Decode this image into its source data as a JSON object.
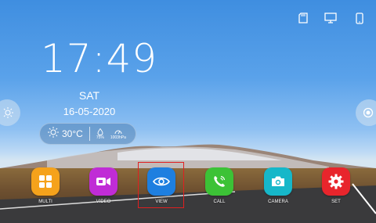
{
  "status_bar": {
    "icons": [
      "sd-card-icon",
      "screen-mirror-icon",
      "phone-icon"
    ]
  },
  "clock": {
    "time": "17:49",
    "day": "SAT",
    "date": "16-05-2020"
  },
  "weather": {
    "temperature": "30°C",
    "humidity": "75%",
    "pressure": "1003hPa"
  },
  "dock": {
    "apps": [
      {
        "label": "MULTI",
        "color": "#f5a21b",
        "icon": "grid-icon"
      },
      {
        "label": "VIDEO",
        "color": "#c02cd6",
        "icon": "video-icon"
      },
      {
        "label": "VIEW",
        "color": "#1e7fe0",
        "icon": "eye-icon"
      },
      {
        "label": "CALL",
        "color": "#3cc236",
        "icon": "call-icon"
      },
      {
        "label": "CAMERA",
        "color": "#16b7c9",
        "icon": "camera-icon"
      },
      {
        "label": "SET",
        "color": "#e8252c",
        "icon": "gear-icon"
      }
    ],
    "selected": "VIEW"
  },
  "colors": {
    "highlight": "#e02020"
  }
}
